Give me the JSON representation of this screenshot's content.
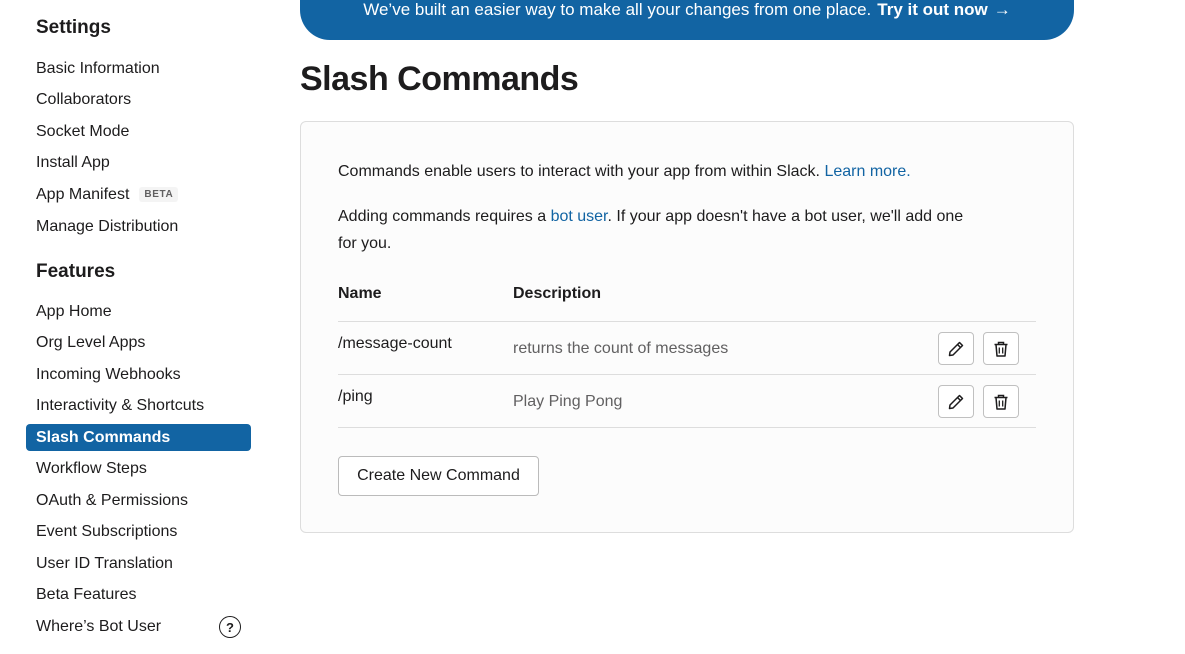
{
  "sidebar": {
    "settings_heading": "Settings",
    "settings_items": [
      {
        "label": "Basic Information"
      },
      {
        "label": "Collaborators"
      },
      {
        "label": "Socket Mode"
      },
      {
        "label": "Install App"
      },
      {
        "label": "App Manifest",
        "badge": "BETA"
      },
      {
        "label": "Manage Distribution"
      }
    ],
    "features_heading": "Features",
    "features_items": [
      {
        "label": "App Home"
      },
      {
        "label": "Org Level Apps"
      },
      {
        "label": "Incoming Webhooks"
      },
      {
        "label": "Interactivity & Shortcuts"
      },
      {
        "label": "Slash Commands",
        "active": true
      },
      {
        "label": "Workflow Steps"
      },
      {
        "label": "OAuth & Permissions"
      },
      {
        "label": "Event Subscriptions"
      },
      {
        "label": "User ID Translation"
      },
      {
        "label": "Beta Features"
      },
      {
        "label": "Where’s Bot User"
      }
    ],
    "help_glyph": "?"
  },
  "banner": {
    "text": "We’ve built an easier way to make all your changes from one place.",
    "cta": "Try it out now",
    "arrow": "→"
  },
  "page": {
    "title": "Slash Commands"
  },
  "card": {
    "intro_text": "Commands enable users to interact with your app from within Slack.",
    "learn_more": "Learn more.",
    "bot_prefix": "Adding commands requires a",
    "bot_link": "bot user",
    "bot_suffix_line1": ". If your app doesn't have a bot user, we'll add one",
    "bot_suffix_line2": "for you.",
    "col_name": "Name",
    "col_description": "Description",
    "commands": [
      {
        "name": "/message-count",
        "description": "returns the count of messages"
      },
      {
        "name": "/ping",
        "description": "Play Ping Pong"
      }
    ],
    "create_button": "Create New Command"
  },
  "colors": {
    "accent": "#1264a3",
    "text": "#1d1c1d",
    "muted": "#616061",
    "border": "#dddddd"
  },
  "icons": {
    "edit": "pencil-icon",
    "delete": "trash-icon",
    "help": "question-circle-icon",
    "arrow": "arrow-right-icon"
  }
}
